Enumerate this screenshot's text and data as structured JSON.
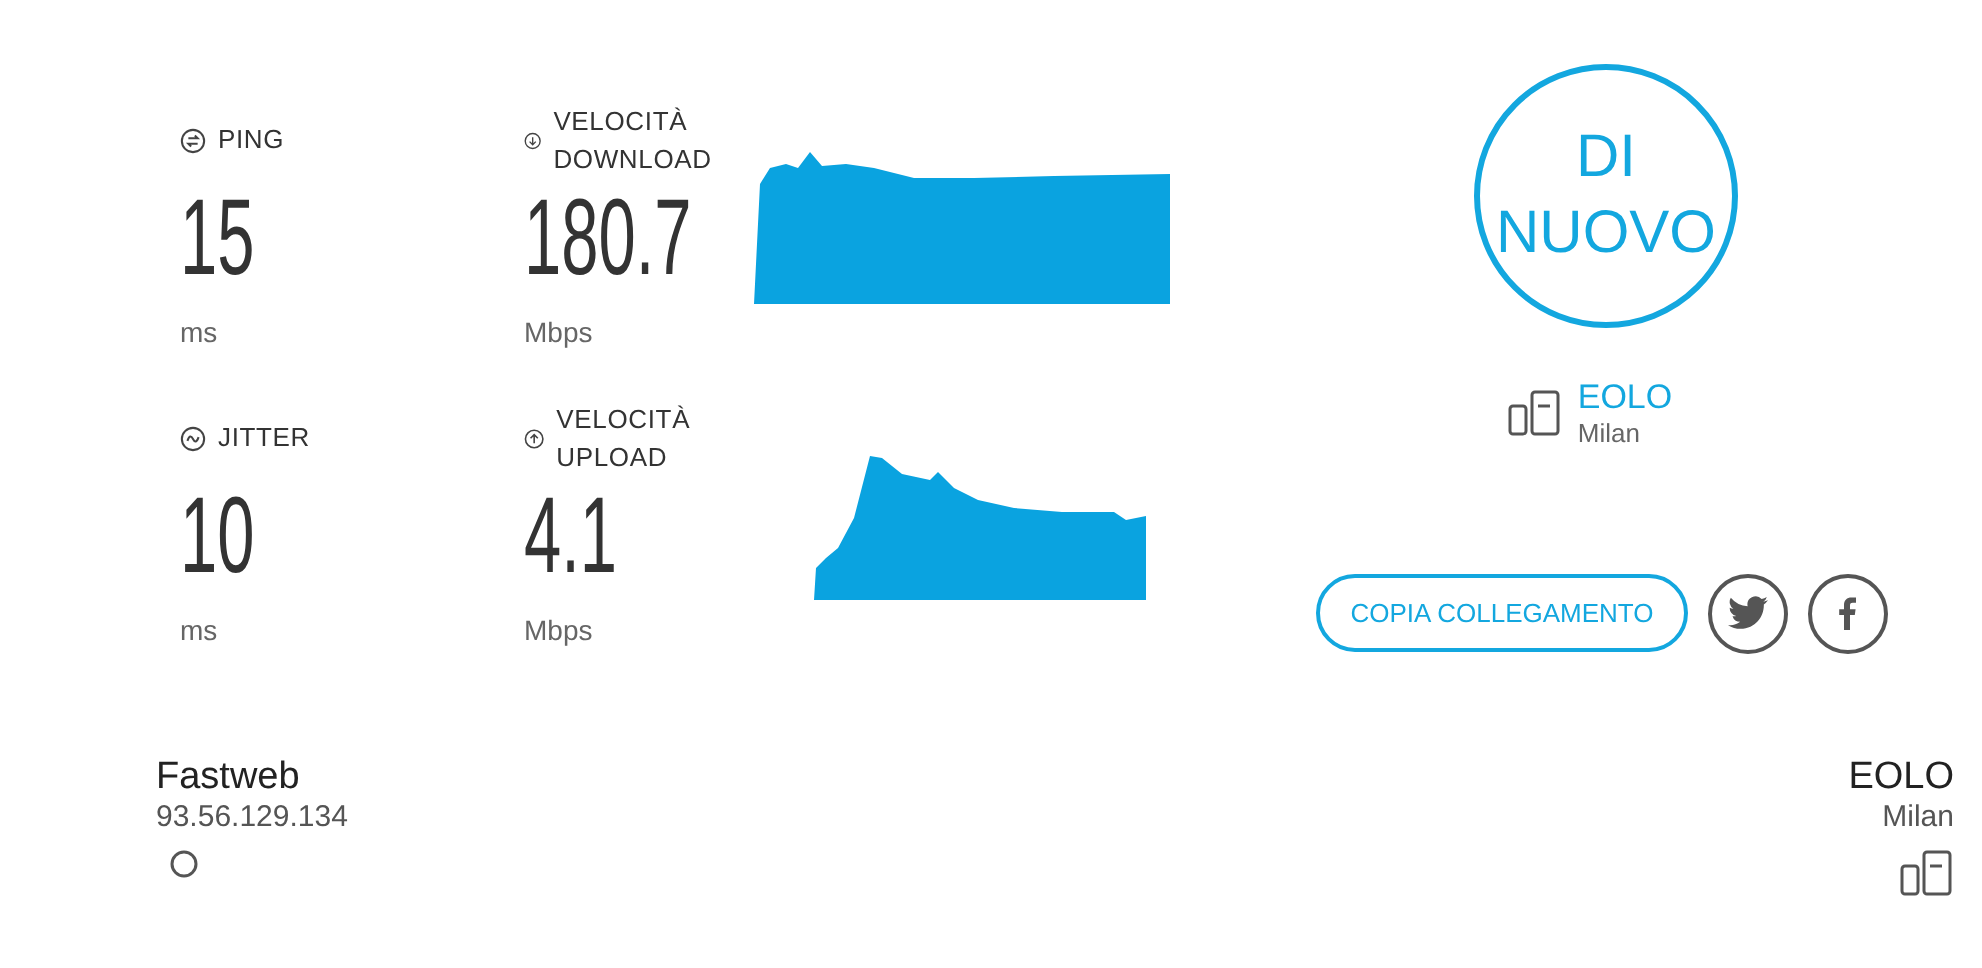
{
  "rows": [
    {
      "latency": {
        "kind": "ping",
        "label": "PING",
        "value": "15",
        "unit": "ms"
      },
      "speed": {
        "kind": "download",
        "label": "VELOCITÀ DOWNLOAD",
        "value": "180.7",
        "unit": "Mbps"
      }
    },
    {
      "latency": {
        "kind": "jitter",
        "label": "JITTER",
        "value": "10",
        "unit": "ms"
      },
      "speed": {
        "kind": "upload",
        "label": "VELOCITÀ UPLOAD",
        "value": "4.1",
        "unit": "Mbps"
      }
    }
  ],
  "again_button": {
    "line1": "DI",
    "line2": "NUOVO"
  },
  "server": {
    "name": "EOLO",
    "city": "Milan"
  },
  "copy_link_button": "COPIA COLLEGAMENTO",
  "share": [
    {
      "kind": "twitter"
    },
    {
      "kind": "facebook"
    }
  ],
  "client": {
    "isp": "Fastweb",
    "ip": "93.56.129.134"
  },
  "host": {
    "name": "EOLO",
    "city": "Milan"
  }
}
